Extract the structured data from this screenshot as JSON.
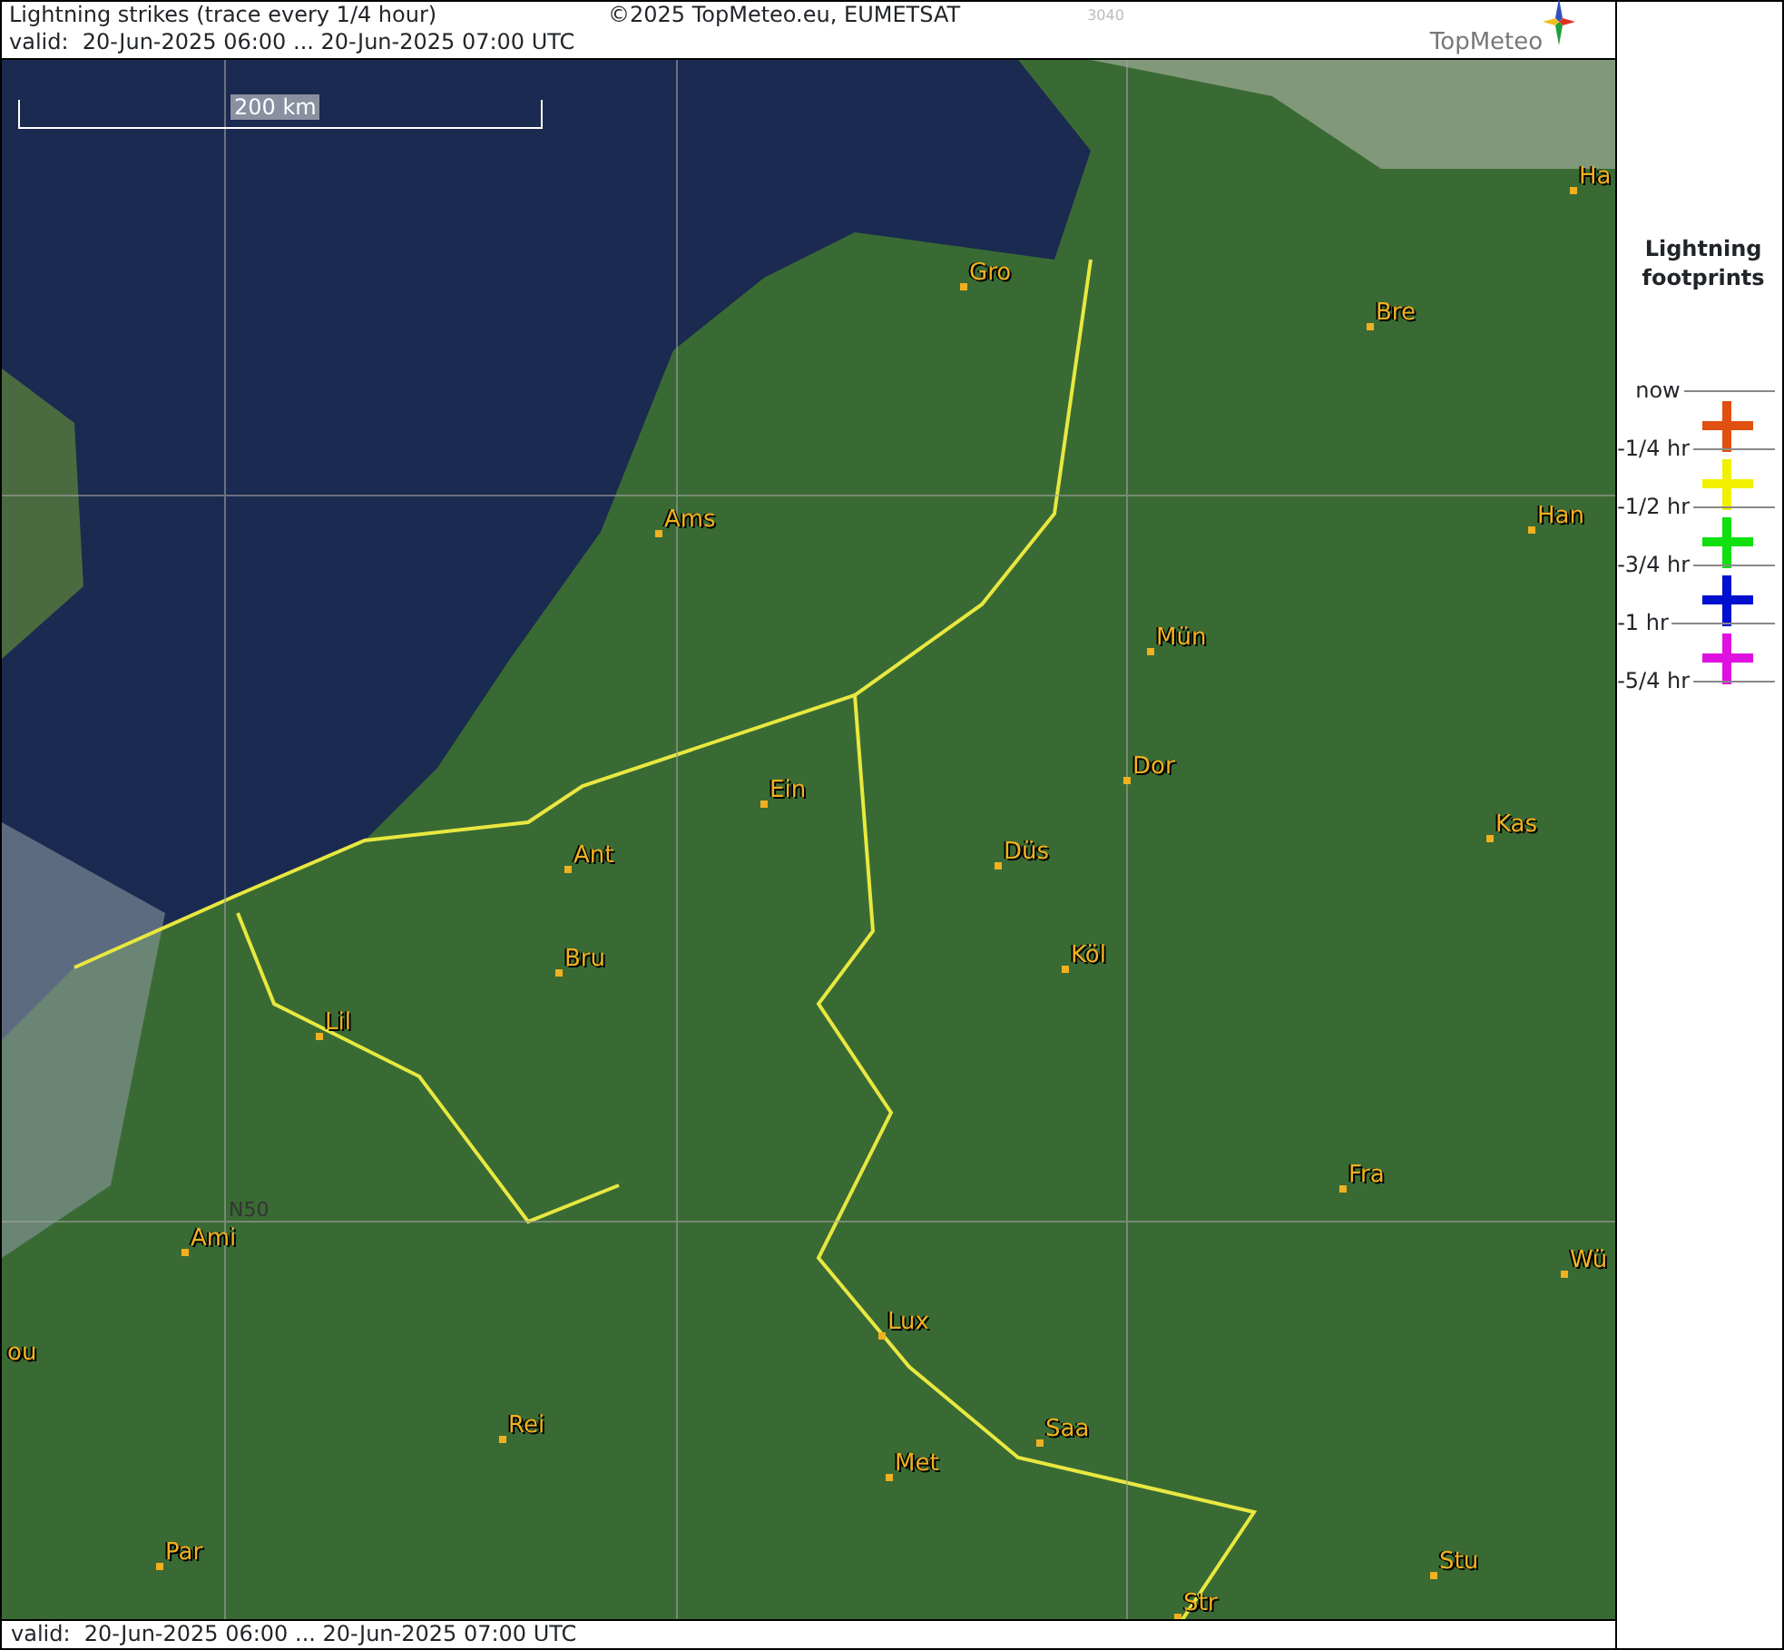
{
  "header": {
    "title": "Lightning strikes (trace every 1/4 hour)",
    "copyright": "©2025 TopMeteo.eu, EUMETSAT",
    "code": "3040",
    "valid": "valid:  20-Jun-2025 06:00 ... 20-Jun-2025 07:00 UTC",
    "logo": "TopMeteo"
  },
  "map": {
    "scale": "200 km",
    "grid_label": "N50",
    "cities": [
      "Gro",
      "Bre",
      "Ha",
      "Ams",
      "Han",
      "Mün",
      "Dor",
      "Ein",
      "Ant",
      "Düs",
      "Kas",
      "Bru",
      "Köl",
      "Lil",
      "Fra",
      "Ami",
      "Wü",
      "Lux",
      "ou",
      "Rei",
      "Saa",
      "Met",
      "Par",
      "Stu",
      "Str"
    ]
  },
  "legend": {
    "title": "Lightning footprints",
    "ticks": [
      "now",
      "-1/4 hr",
      "-1/2 hr",
      "-3/4 hr",
      "-1 hr",
      "-5/4 hr"
    ],
    "markers": [
      {
        "color": "#e05010"
      },
      {
        "color": "#f0f000"
      },
      {
        "color": "#10e010"
      },
      {
        "color": "#0010d0"
      },
      {
        "color": "#e010e0"
      }
    ]
  },
  "footer": {
    "valid": "valid:  20-Jun-2025 06:00 ... 20-Jun-2025 07:00 UTC"
  }
}
